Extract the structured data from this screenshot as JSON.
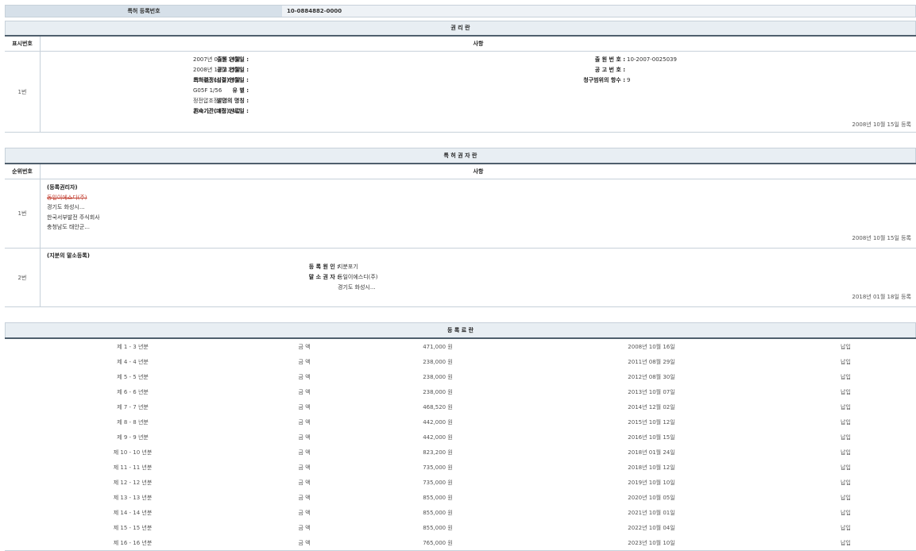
{
  "registration": {
    "label": "특허 등록번호",
    "value": "10-0884882-0000"
  },
  "rights_section": {
    "title": "권 리 란",
    "col_no": "표시번호",
    "col_content": "사항",
    "entry": {
      "no": "1번",
      "left": [
        {
          "k": "출원 연월일 :",
          "v": "2007년 03월 14일"
        },
        {
          "k": "공고 연월일 :",
          "v": "2008년 10월 23일"
        },
        {
          "k": "특허결정(심결)연월일 :",
          "v": "2008년 10월 08일"
        },
        {
          "k": "유 별 :",
          "v": "G05F 1/56"
        },
        {
          "k": "발명의 명칭 :",
          "v": "정전압조정기"
        },
        {
          "k": "존속기간(예정)만료일 :",
          "v": "2027년 03월 14일"
        }
      ],
      "right": [
        {
          "k": "출 원 번 호 :",
          "v": "10-2007-0025039"
        },
        {
          "k": "공 고 번 호 :",
          "v": ""
        },
        {
          "k": "청구범위의 항수 :",
          "v": "9"
        }
      ],
      "reg_date": "2008년 10월 15일 등록"
    }
  },
  "owner_section": {
    "title": "특 허 권 자 란",
    "col_no": "순위번호",
    "col_content": "사항",
    "entry1": {
      "no": "1번",
      "heading": "(등록권리자)",
      "struck": "동일이에스디(주)",
      "lines": [
        "경기도 화성시...",
        "한국서부발전 주식회사",
        "충청남도 태안군..."
      ],
      "reg_date": "2008년 10월 15일 등록"
    },
    "entry2": {
      "no": "2번",
      "heading": "(지분의 말소등록)",
      "cause_label": "등 록 원 인 :",
      "cause_value": "지분포기",
      "erased_label": "말 소 권 자 :",
      "erased_value": "동일이에스디(주)",
      "erased_addr": "경기도 화성시...",
      "reg_date": "2018년 01월 18일 등록"
    }
  },
  "fee_section": {
    "title": "등 록 료 란",
    "rows": [
      {
        "period": "제 1 - 3 년분",
        "label": "금 액",
        "amount": "471,000 원",
        "date": "2008년 10월 16일",
        "status": "납입"
      },
      {
        "period": "제 4 - 4 년분",
        "label": "금 액",
        "amount": "238,000 원",
        "date": "2011년 08월 29일",
        "status": "납입"
      },
      {
        "period": "제 5 - 5 년분",
        "label": "금 액",
        "amount": "238,000 원",
        "date": "2012년 08월 30일",
        "status": "납입"
      },
      {
        "period": "제 6 - 6 년분",
        "label": "금 액",
        "amount": "238,000 원",
        "date": "2013년 10월 07일",
        "status": "납입"
      },
      {
        "period": "제 7 - 7 년분",
        "label": "금 액",
        "amount": "468,520 원",
        "date": "2014년 12월 02일",
        "status": "납입"
      },
      {
        "period": "제 8 - 8 년분",
        "label": "금 액",
        "amount": "442,000 원",
        "date": "2015년 10월 12일",
        "status": "납입"
      },
      {
        "period": "제 9 - 9 년분",
        "label": "금 액",
        "amount": "442,000 원",
        "date": "2016년 10월 15일",
        "status": "납입"
      },
      {
        "period": "제 10 - 10 년분",
        "label": "금 액",
        "amount": "823,200 원",
        "date": "2018년 01월 24일",
        "status": "납입"
      },
      {
        "period": "제 11 - 11 년분",
        "label": "금 액",
        "amount": "735,000 원",
        "date": "2018년 10월 12일",
        "status": "납입"
      },
      {
        "period": "제 12 - 12 년분",
        "label": "금 액",
        "amount": "735,000 원",
        "date": "2019년 10월 10일",
        "status": "납입"
      },
      {
        "period": "제 13 - 13 년분",
        "label": "금 액",
        "amount": "855,000 원",
        "date": "2020년 10월 05일",
        "status": "납입"
      },
      {
        "period": "제 14 - 14 년분",
        "label": "금 액",
        "amount": "855,000 원",
        "date": "2021년 10월 01일",
        "status": "납입"
      },
      {
        "period": "제 15 - 15 년분",
        "label": "금 액",
        "amount": "855,000 원",
        "date": "2022년 10월 04일",
        "status": "납입"
      },
      {
        "period": "제 16 - 16 년분",
        "label": "금 액",
        "amount": "765,000 원",
        "date": "2023년 10월 10일",
        "status": "납입"
      }
    ]
  }
}
